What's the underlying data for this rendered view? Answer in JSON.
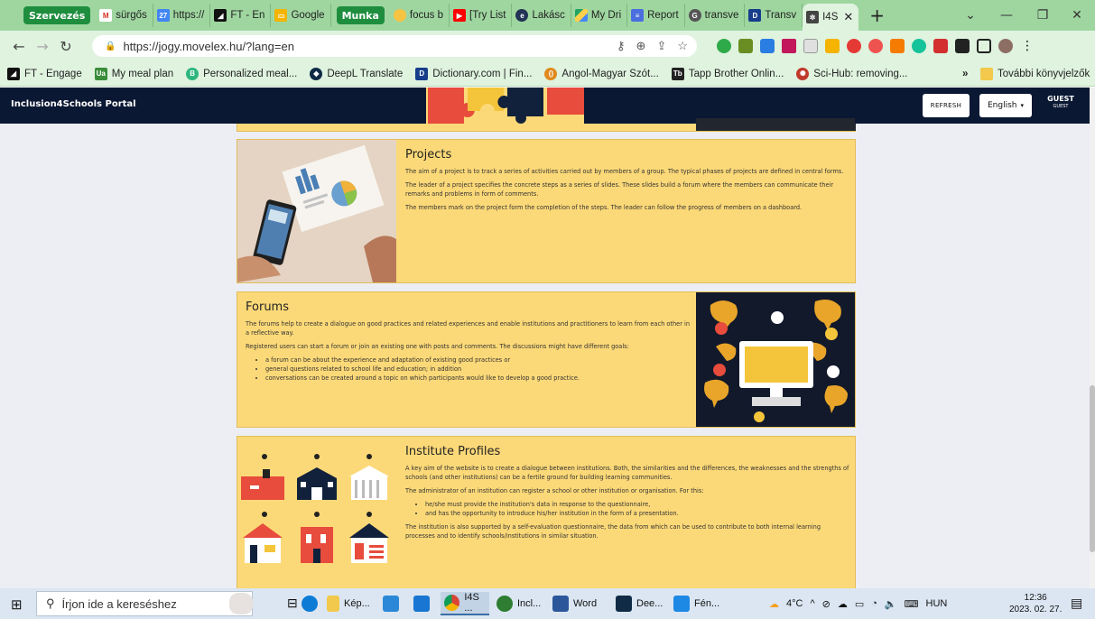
{
  "browser": {
    "tab_group_1": "Szervezés",
    "tab_group_2": "Munka",
    "tabs": [
      {
        "label": "sürgős",
        "icon": "gmail-icon",
        "color": "#d93025"
      },
      {
        "label": "https://",
        "icon": "calendar-icon",
        "color": "#4285f4"
      },
      {
        "label": "FT - En",
        "icon": "ft-icon",
        "color": "#111111"
      },
      {
        "label": "Google",
        "icon": "google-slides-icon",
        "color": "#f4b400"
      },
      {
        "label": "focus b",
        "icon": "focus-icon",
        "color": "#f6c342"
      },
      {
        "label": "[Try List",
        "icon": "youtube-icon",
        "color": "#ff0000"
      },
      {
        "label": "Lakásc",
        "icon": "elte-icon",
        "color": "#223355"
      },
      {
        "label": "My Dri",
        "icon": "google-drive-icon",
        "color": "#1fa463"
      },
      {
        "label": "Report",
        "icon": "google-forms-icon",
        "color": "#4a6ee0"
      },
      {
        "label": "transve",
        "icon": "google-search-icon",
        "color": "#555555"
      },
      {
        "label": "Transv",
        "icon": "dictionary-icon",
        "color": "#163e8a"
      },
      {
        "label": "I4S",
        "icon": "i4s-icon",
        "color": "#444444",
        "active": true
      }
    ],
    "url": "https://jogy.movelex.hu/?lang=en"
  },
  "bookmarks": [
    {
      "label": "FT - Engage",
      "icon": "ft-icon",
      "color": "#111111"
    },
    {
      "label": "My meal plan",
      "icon": "meal-plan-icon",
      "color": "#3a8d3a"
    },
    {
      "label": "Personalized meal...",
      "icon": "meal-icon",
      "color": "#2eb67d"
    },
    {
      "label": "DeepL Translate",
      "icon": "deepl-icon",
      "color": "#0f2b46"
    },
    {
      "label": "Dictionary.com | Fin...",
      "icon": "dictionary-icon",
      "color": "#163e8a"
    },
    {
      "label": "Angol-Magyar Szót...",
      "icon": "sztaki-icon",
      "color": "#e08a1e"
    },
    {
      "label": "Tapp Brother Onlin...",
      "icon": "tapp-icon",
      "color": "#222222"
    },
    {
      "label": "Sci-Hub: removing...",
      "icon": "scihub-icon",
      "color": "#c0392b"
    }
  ],
  "other_bookmarks": "További könyvjelzők",
  "app": {
    "title": "Inclusion4Schools Portal",
    "refresh_label": "REFRESH",
    "language": "English",
    "guest_name": "GUEST",
    "guest_role": "GUEST"
  },
  "cards": {
    "projects": {
      "title": "Projects",
      "paragraphs": [
        "The aim of a project is to track a series of activities carried out by members of a group. The typical phases of projects are defined in central forms.",
        "The leader of a project specifies the concrete steps as a series of slides. These slides build a forum where the members can communicate their remarks and problems in form of comments.",
        "The members mark on the project form the completion of the steps. The leader can follow the progress of members on a dashboard."
      ]
    },
    "forums": {
      "title": "Forums",
      "paragraphs": [
        "The forums help to create a dialogue on good practices and related experiences and enable institutions and practitioners to learn from each other in a reflective way.",
        "Registered users can start a forum or join an existing one with posts and comments. The discussions might have different goals:"
      ],
      "bullets": [
        "a forum can be about the experience and adaptation of existing good practices or",
        "general questions related to school life and education; in addition",
        "conversations can be created around a topic on which participants would like to develop a good practice."
      ]
    },
    "institutes": {
      "title": "Institute Profiles",
      "paragraphs": [
        "A key aim of the website is to create a dialogue between institutions. Both, the similarities and the differences, the weaknesses and the strengths of schools (and other institutions) can be a fertile ground for building learning communities.",
        "The administrator of an institution can register a school or other institution or organisation. For this:"
      ],
      "bullets": [
        "he/she must provide the institution's data in response to the questionnaire,",
        "and has the opportunity to introduce his/her institution in the form of a presentation."
      ],
      "closing": "The institution is also supported by a self-evaluation questionnaire, the data from which can be used to contribute to both internal learning processes and to identify schools/institutions in similar situation."
    }
  },
  "taskbar": {
    "search_placeholder": "Írjon ide a kereséshez",
    "apps": [
      {
        "label": "Kép...",
        "icon": "file-explorer-icon"
      },
      {
        "label": "I4S ...",
        "icon": "chrome-icon"
      },
      {
        "label": "Incl...",
        "icon": "chrome-profile-icon"
      },
      {
        "label": "Word",
        "icon": "word-icon"
      },
      {
        "label": "Dee...",
        "icon": "deepl-icon"
      },
      {
        "label": "Fén...",
        "icon": "photos-icon"
      }
    ],
    "weather": "4°C",
    "language": "HUN",
    "time": "12:36",
    "date": "2023. 02. 27."
  }
}
